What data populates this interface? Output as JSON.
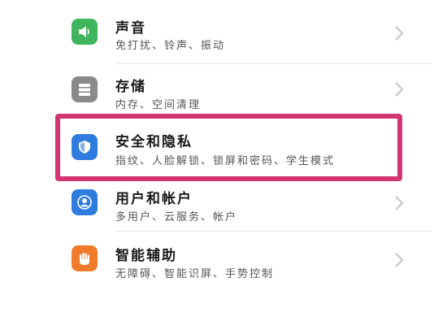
{
  "settings": {
    "items": [
      {
        "label": "声音",
        "subtitle": "免打扰、铃声、振动",
        "icon": "speaker-icon",
        "color": "#3fb55d"
      },
      {
        "label": "存储",
        "subtitle": "内存、空间清理",
        "icon": "storage-icon",
        "color": "#8a8a8a"
      },
      {
        "label": "安全和隐私",
        "subtitle": "指纹、人脸解锁、锁屏和密码、学生模式",
        "icon": "shield-icon",
        "color": "#2f7ce0"
      },
      {
        "label": "用户和帐户",
        "subtitle": "多用户、云服务、帐户",
        "icon": "user-icon",
        "color": "#2f7ce0"
      },
      {
        "label": "智能辅助",
        "subtitle": "无障碍、智能识屏、手势控制",
        "icon": "hand-icon",
        "color": "#f07b2a"
      }
    ]
  },
  "highlight_color": "#d2356f"
}
